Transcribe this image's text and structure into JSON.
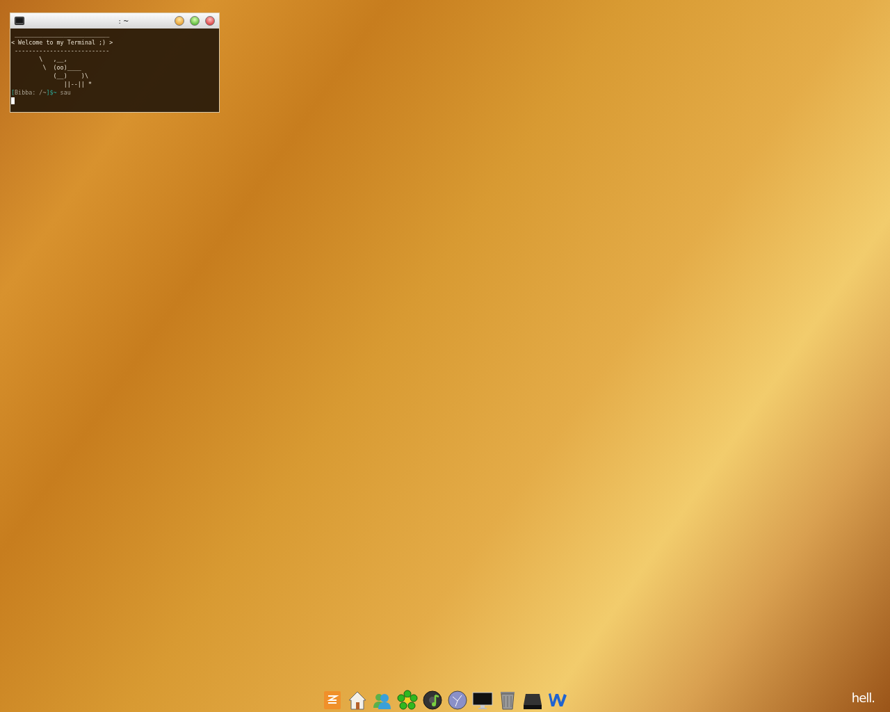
{
  "terminal": {
    "title": ": ~",
    "lines": [
      " ___________________________",
      "< Welcome to my Terminal ;) >",
      " ---------------------------",
      "        \\   ,__,",
      "         \\  (oo)____",
      "            (__)    )\\",
      "               ||--|| *"
    ],
    "prompt": {
      "open": "[",
      "host": "Bibba: /~",
      "close": "]$~",
      "command": "sau"
    }
  },
  "desktop": {
    "label": "hell."
  }
}
